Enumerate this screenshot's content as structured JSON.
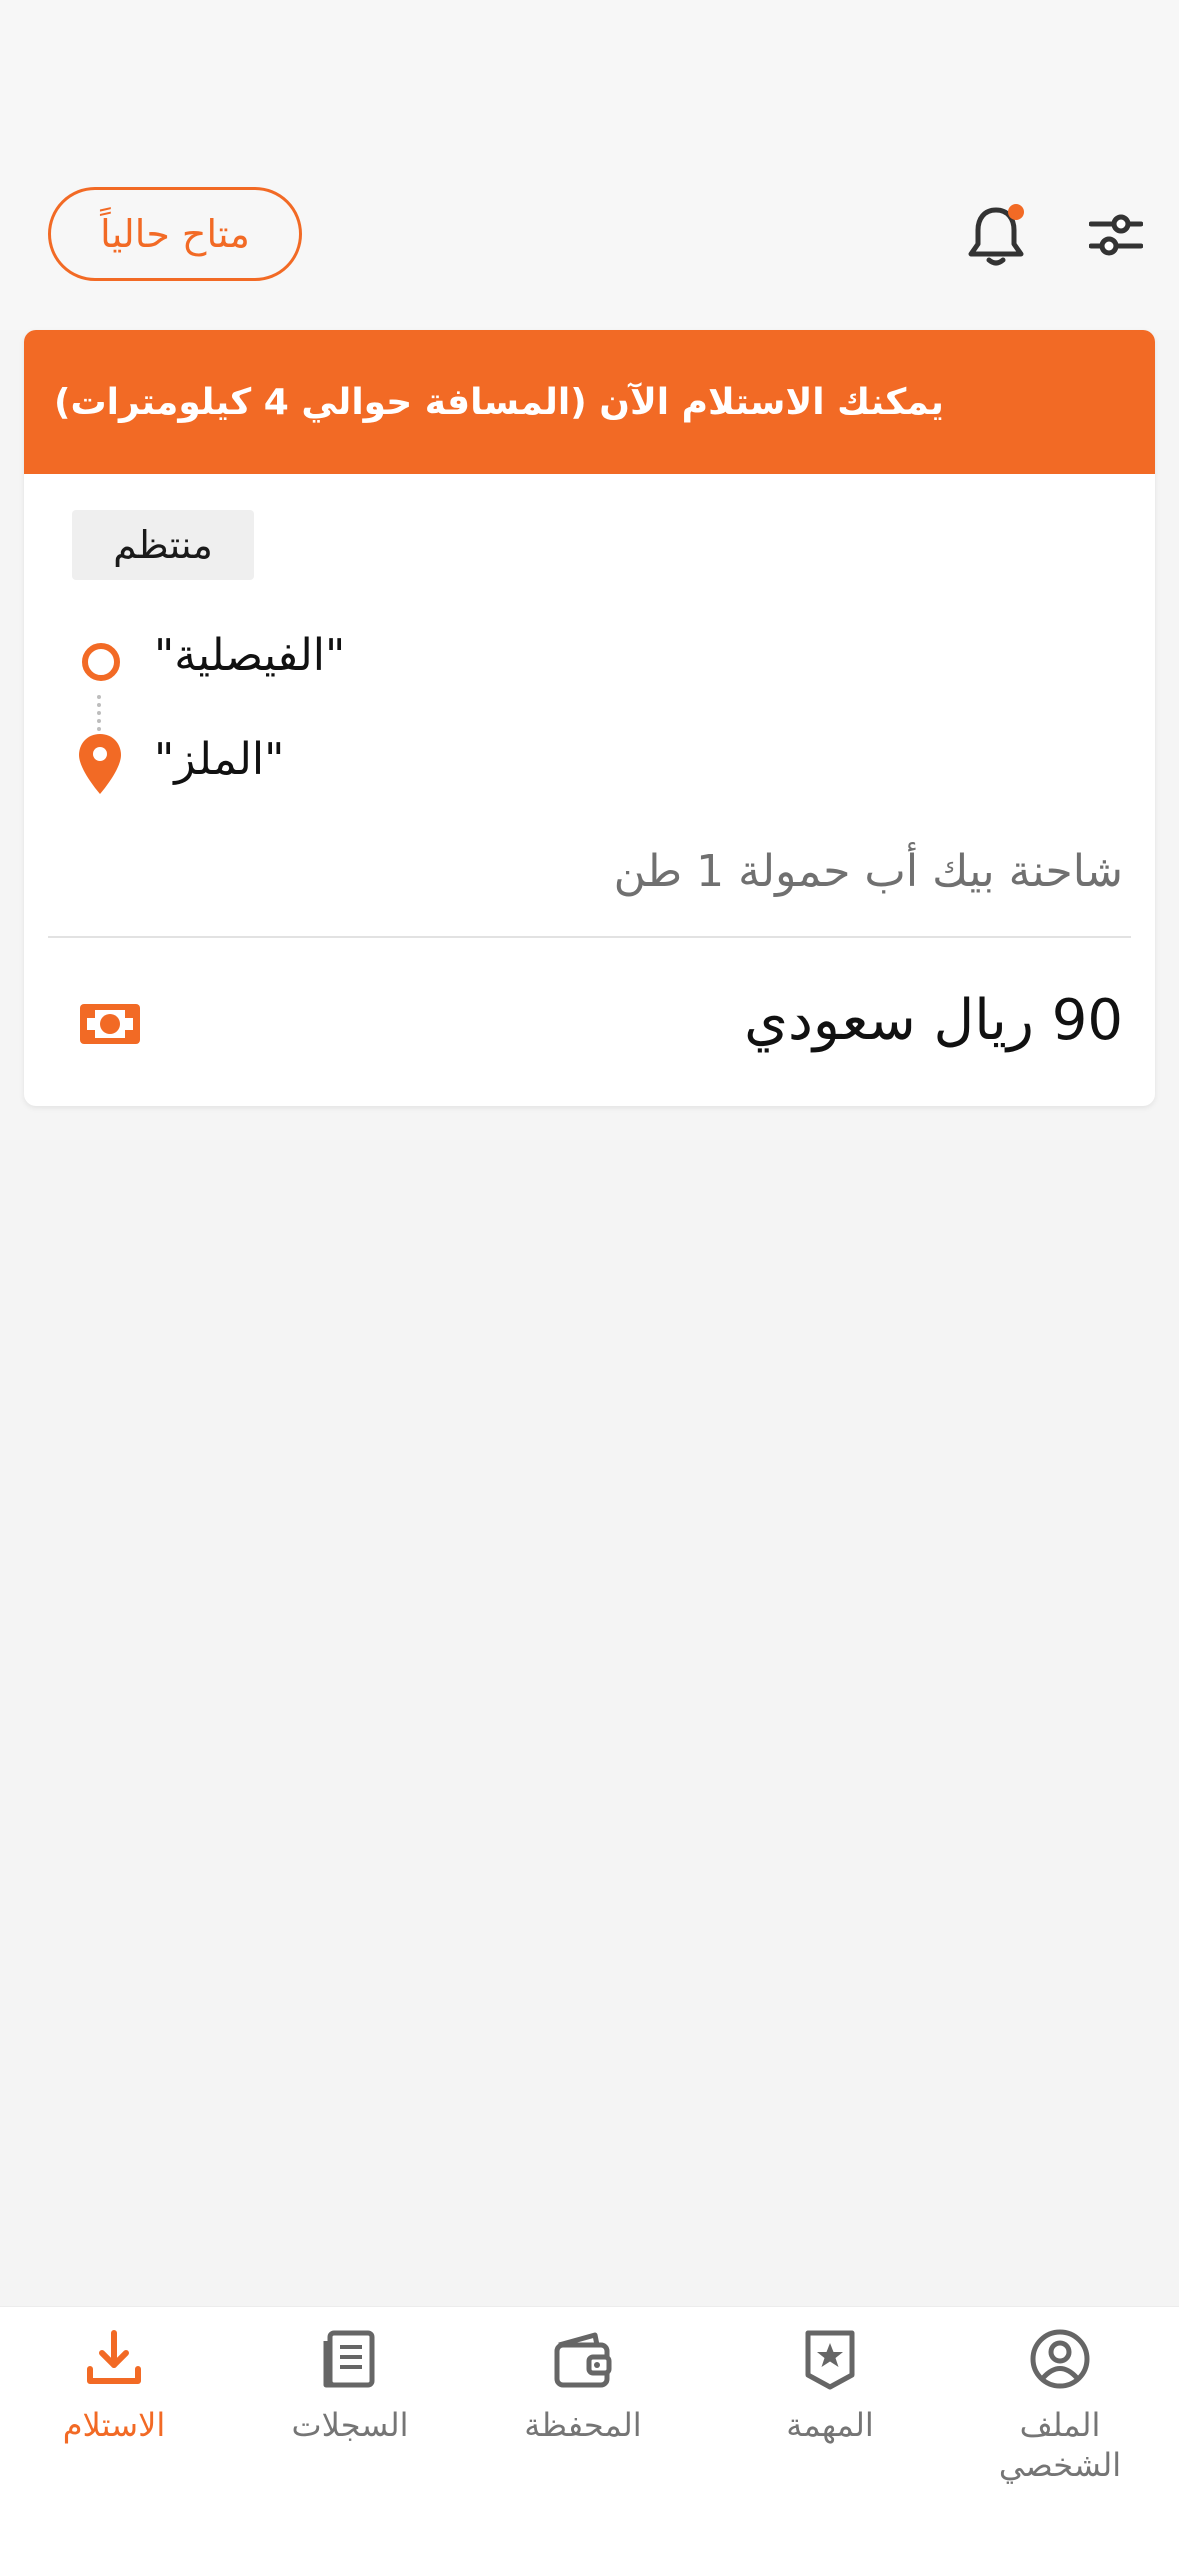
{
  "header": {
    "availability_label": "متاح حالياً",
    "bell_icon": "bell-icon",
    "filter_icon": "sliders-icon",
    "notification_dot_color": "#f26a25"
  },
  "order_card": {
    "banner_text": "يمكنك الاستلام الآن (المسافة حوالي 4 كيلومترات)",
    "tag": "منتظم",
    "origin": "\"الفيصلية\"",
    "destination": "\"الملز\"",
    "vehicle": "شاحنة بيك أب حمولة 1 طن",
    "price": "90 ريال سعودي",
    "money_icon": "money-icon"
  },
  "bottom_nav": {
    "items": [
      {
        "label": "الاستلام",
        "icon": "download-icon",
        "active": true
      },
      {
        "label": "السجلات",
        "icon": "records-icon",
        "active": false
      },
      {
        "label": "المحفظة",
        "icon": "wallet-icon",
        "active": false
      },
      {
        "label": "المهمة",
        "icon": "star-badge-icon",
        "active": false
      },
      {
        "label": "الملف الشخصي",
        "icon": "profile-icon",
        "active": false
      }
    ]
  },
  "colors": {
    "accent": "#f26a25",
    "text_muted": "#757575",
    "background": "#f5f5f5"
  }
}
